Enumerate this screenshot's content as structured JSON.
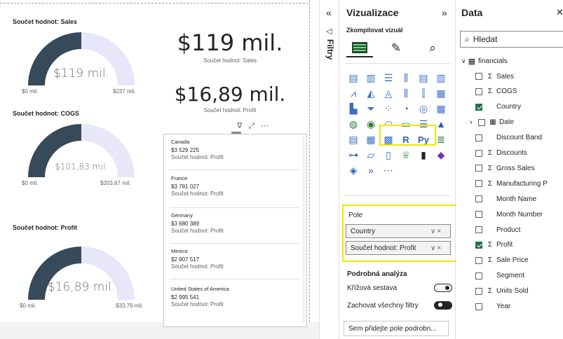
{
  "canvas": {
    "gauges": [
      {
        "title": "Součet hodnot: Sales",
        "value": "$119 mil.",
        "min": "$0 mil.",
        "max": "$237 mil.",
        "fill": 0.5
      },
      {
        "title": "Součet hodnot: COGS",
        "value": "$101,83 mil.",
        "min": "$0 mil.",
        "max": "$203,67 mil.",
        "fill": 0.5
      },
      {
        "title": "Součet hodnot: Profit",
        "value": "$16,89 mil.",
        "min": "$0 mil.",
        "max": "$33,79 mil.",
        "fill": 0.5
      }
    ],
    "cards": [
      {
        "value": "$119 mil.",
        "label": "Součet hodnot:  Sales"
      },
      {
        "value": "$16,89 mil.",
        "label": "Součet hodnot: Profit"
      }
    ],
    "multirow": [
      {
        "country": "Canada",
        "value": "$3 529 225",
        "measure": "Součet hodnot: Profit"
      },
      {
        "country": "France",
        "value": "$3 781 027",
        "measure": "Součet hodnot: Profit"
      },
      {
        "country": "Germany",
        "value": "$3 680 389",
        "measure": "Součet hodnot: Profit"
      },
      {
        "country": "Mexico",
        "value": "$2 907 517",
        "measure": "Součet hodnot: Profit"
      },
      {
        "country": "United States of America",
        "value": "$2 995 541",
        "measure": "Součet hodnot: Profit"
      }
    ],
    "gauge_colors": {
      "filled": "#374a59",
      "empty": "#e8e6f9"
    }
  },
  "filters": {
    "label": "Filtry"
  },
  "viz_pane": {
    "title": "Vizualizace",
    "build_label": "Zkompilovat vizuál",
    "fields_label": "Pole",
    "fields": [
      {
        "label": "Country"
      },
      {
        "label": "Součet hodnot: Profit"
      }
    ],
    "drill_title": "Podrobná analýza",
    "cross_report_label": "Křížová sestava",
    "keep_filters_label": "Zachovat všechny filtry",
    "keep_filters_on": true,
    "cross_report_on": false,
    "drill_placeholder": "Sem přidejte pole podrobn...",
    "icons": [
      "stacked-bar-icon",
      "stacked-column-icon",
      "clustered-bar-icon",
      "clustered-column-icon",
      "100-bar-icon",
      "100-column-icon",
      "line-chart-icon",
      "area-chart-icon",
      "stacked-area-icon",
      "line-column-icon",
      "line-clustered-icon",
      "ribbon-chart-icon",
      "waterfall-icon",
      "funnel-icon",
      "scatter-icon",
      "pie-icon",
      "donut-icon",
      "treemap-icon",
      "map-icon",
      "filled-map-icon",
      "gauge-icon",
      "card-icon",
      "multirow-card-icon",
      "kpi-icon",
      "slicer-icon",
      "table-icon",
      "matrix-icon",
      "r-visual-icon",
      "python-visual-icon",
      "key-influencers-icon",
      "decomposition-tree-icon",
      "qa-icon",
      "narrative-icon",
      "goals-icon",
      "paginated-icon",
      "power-apps-icon",
      "power-automate-icon",
      "more-visuals-icon",
      "ellipsis-icon"
    ]
  },
  "data_pane": {
    "title": "Data",
    "search_placeholder": "Hledat",
    "table_name": "financials",
    "fields": [
      {
        "name": "Sales",
        "sigma": true,
        "checked": false
      },
      {
        "name": "COGS",
        "sigma": true,
        "checked": false
      },
      {
        "name": "Country",
        "sigma": false,
        "checked": true
      },
      {
        "name": "Date",
        "sigma": false,
        "checked": false,
        "calendar": true,
        "expand": true
      },
      {
        "name": "Discount Band",
        "sigma": false,
        "checked": false
      },
      {
        "name": "Discounts",
        "sigma": true,
        "checked": false
      },
      {
        "name": "Gross Sales",
        "sigma": true,
        "checked": false
      },
      {
        "name": "Manufacturing P",
        "sigma": true,
        "checked": false
      },
      {
        "name": "Month Name",
        "sigma": false,
        "checked": false
      },
      {
        "name": "Month Number",
        "sigma": false,
        "checked": false
      },
      {
        "name": "Product",
        "sigma": false,
        "checked": false
      },
      {
        "name": "Profit",
        "sigma": true,
        "checked": true
      },
      {
        "name": "Sale Price",
        "sigma": true,
        "checked": false
      },
      {
        "name": "Segment",
        "sigma": false,
        "checked": false
      },
      {
        "name": "Units Sold",
        "sigma": true,
        "checked": false
      },
      {
        "name": "Year",
        "sigma": false,
        "checked": false
      }
    ]
  }
}
